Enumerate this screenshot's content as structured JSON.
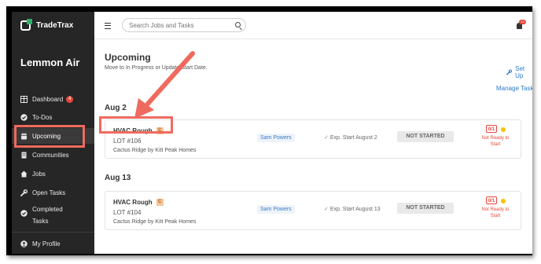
{
  "app": {
    "name": "TradeTrax",
    "company": "Lemmon Air"
  },
  "sidebar": {
    "items": [
      {
        "label": "Dashboard",
        "icon": "dashboard-icon",
        "badge": "4"
      },
      {
        "label": "To-Dos",
        "icon": "check-circle-icon"
      },
      {
        "label": "Upcoming",
        "icon": "calendar-icon",
        "active": true
      },
      {
        "label": "Communities",
        "icon": "building-icon"
      },
      {
        "label": "Jobs",
        "icon": "home-icon"
      },
      {
        "label": "Open Tasks",
        "icon": "wrench-icon"
      },
      {
        "label": "Completed Tasks",
        "icon": "check-circle-icon"
      },
      {
        "label": "My Profile",
        "icon": "user-icon"
      }
    ]
  },
  "topbar": {
    "search_placeholder": "Search Jobs and Tasks",
    "notification_count": "10"
  },
  "page": {
    "title": "Upcoming",
    "subtitle": "Move to In Progress or Update Start Date.",
    "setup_label": "Set Up",
    "manage_label": "Manage Tasks"
  },
  "sections": [
    {
      "date": "Aug 2",
      "task": {
        "name": "HVAC Rough",
        "badge": "C",
        "lot": "LOT #106",
        "community": "Cactus Ridge by Kitt Peak Homes",
        "assignee": "Sam Powers",
        "exp_start": "Exp. Start August 2",
        "status": "NOT STARTED",
        "counter": "0/1",
        "readiness": "Not Ready to Start"
      }
    },
    {
      "date": "Aug 13",
      "task": {
        "name": "HVAC Rough",
        "badge": "C",
        "lot": "LOT #104",
        "community": "Cactus Ridge by Kitt Peak Homes",
        "assignee": "Sam Powers",
        "exp_start": "Exp. Start August 13",
        "status": "NOT STARTED",
        "counter": "0/1",
        "readiness": "Not Ready to Start"
      }
    }
  ],
  "colors": {
    "sidebar_bg": "#262626",
    "accent_blue": "#2d79c9",
    "annotation_red": "#ef6a5e",
    "alert_red": "#e8463b",
    "logo_green": "#2fb36a"
  }
}
